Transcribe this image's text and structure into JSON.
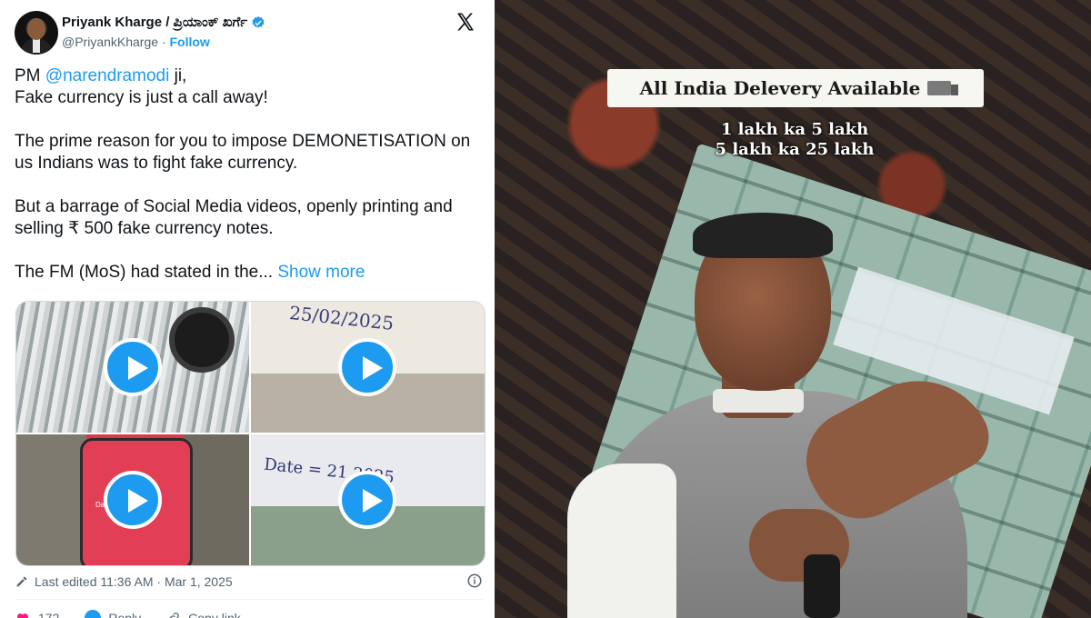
{
  "tweet": {
    "author_name": "Priyank Kharge / ಪ್ರಿಯಾಂಕ್ ಖರ್ಗೆ",
    "handle": "@PriyankKharge",
    "separator": "·",
    "follow_label": "Follow",
    "line1_prefix": "PM ",
    "mention": "@narendramodi",
    "line1_suffix": " ji,",
    "line2": "Fake currency is just a call away!",
    "para2": "The prime reason for you to impose DEMONETISATION on us Indians was to fight fake currency.",
    "para3": "But a barrage of Social Media videos, openly printing and selling ₹ 500 fake currency notes.",
    "para4": "The FM (MoS) had stated in the...",
    "show_more": "Show more",
    "media": {
      "tile2_note": "25/02/2025",
      "tile3_phone_text": "Da",
      "tile4_note": "Date = 21 2025"
    },
    "last_edited": "Last edited 11:36 AM · Mar 1, 2025",
    "like_count": "172",
    "reply_label": "Reply",
    "copy_link_label": "Copy link",
    "icons": {
      "avatar": "avatar",
      "verified": "verified-badge-icon",
      "x_logo": "x-logo-icon",
      "play": "play-icon",
      "edit": "pencil-icon",
      "info": "info-icon",
      "like": "heart-icon",
      "reply": "reply-icon",
      "link": "link-icon"
    },
    "colors": {
      "accent": "#1d9bf0",
      "text": "#0f1419",
      "muted": "#536471",
      "like": "#f91880"
    }
  },
  "photo": {
    "banner_text": "All India Delevery Available",
    "offer_line1": "1 lakh ka 5 lakh",
    "offer_line2": "5 lakh ka 25 lakh"
  }
}
